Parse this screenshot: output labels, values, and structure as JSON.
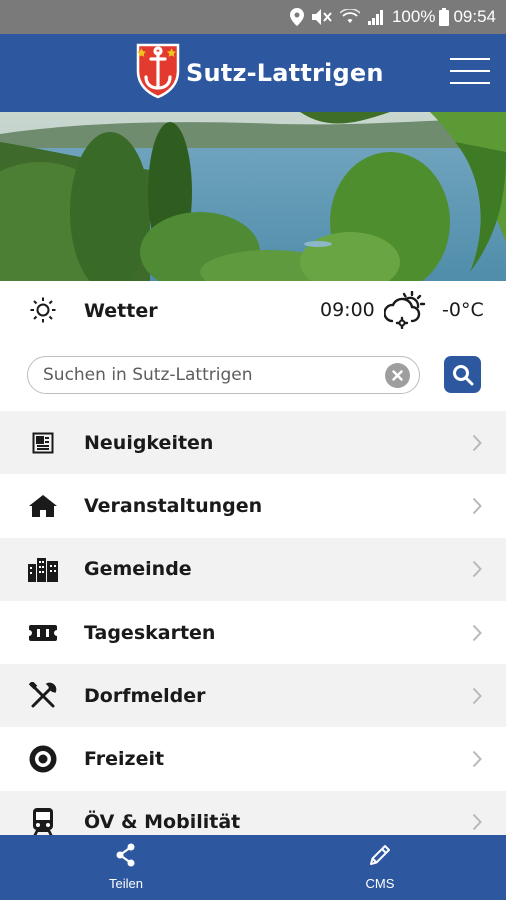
{
  "status_bar": {
    "battery": "100%",
    "time": "09:54",
    "icons": [
      "location-icon",
      "mute-icon",
      "wifi-icon",
      "signal-icon",
      "battery-icon"
    ]
  },
  "header": {
    "title": "Sutz-Lattrigen",
    "logo": "coat-of-arms-anchor",
    "menu_icon": "hamburger-icon"
  },
  "weather": {
    "label": "Wetter",
    "time": "09:00",
    "temperature": "-0°C",
    "icon": "sun-cloud-icon"
  },
  "search": {
    "placeholder": "Suchen in Sutz-Lattrigen",
    "value": ""
  },
  "menu": {
    "items": [
      {
        "label": "Neuigkeiten",
        "icon": "newspaper-icon"
      },
      {
        "label": "Veranstaltungen",
        "icon": "tent-icon"
      },
      {
        "label": "Gemeinde",
        "icon": "buildings-icon"
      },
      {
        "label": "Tageskarten",
        "icon": "ticket-icon"
      },
      {
        "label": "Dorfmelder",
        "icon": "tools-icon"
      },
      {
        "label": "Freizeit",
        "icon": "target-icon"
      },
      {
        "label": "ÖV & Mobilität",
        "icon": "train-icon"
      }
    ]
  },
  "bottom_nav": {
    "share_label": "Teilen",
    "cms_label": "CMS"
  },
  "colors": {
    "primary": "#2d58a0",
    "status_bar": "#7a7a7a",
    "row_alt": "#f2f2f2",
    "text": "#1a1a1a"
  }
}
